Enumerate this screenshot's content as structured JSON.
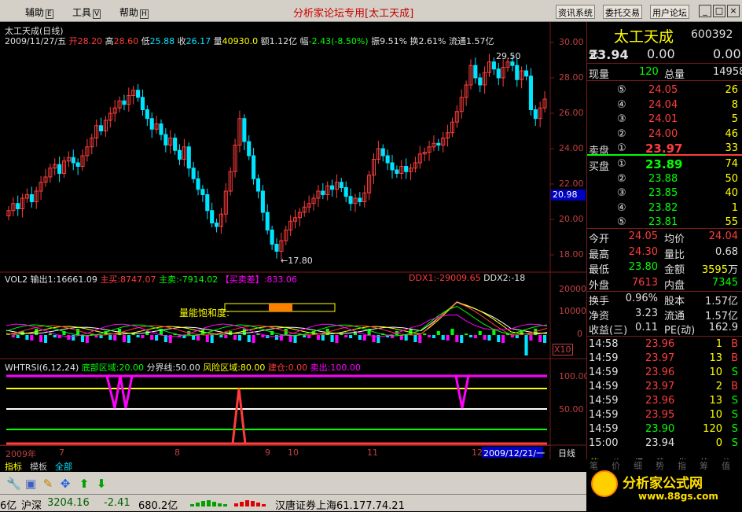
{
  "menubar": {
    "items": [
      {
        "label": "辅助",
        "key": "E"
      },
      {
        "label": "工具",
        "key": "V"
      },
      {
        "label": "帮助",
        "key": "H"
      }
    ],
    "app_title": "分析家论坛专用",
    "stock_bracket": "[太工天成]",
    "buttons": [
      "资讯系统",
      "委托交易",
      "用户论坛"
    ],
    "win_min": "_",
    "win_max": "□",
    "win_close": "×"
  },
  "price_panel": {
    "title": "太工天成(日线)",
    "date": "2009/11/27/五",
    "open_label": "开",
    "open": "28.20",
    "high_label": "高",
    "high": "28.60",
    "low_label": "低",
    "low": "25.88",
    "close_label": "收",
    "close": "26.17",
    "vol_label": "量",
    "vol": "40930.0",
    "amount_label": "额",
    "amount": "1.12亿",
    "change_label": "幅",
    "change": "-2.43(-8.50%)",
    "amp_label": "振",
    "amp": "9.51%",
    "turn_label": "换",
    "turn": "2.61%",
    "float_label": "流通",
    "float": "1.57亿",
    "peak_label": "29.50",
    "trough_label": "17.80",
    "y_ticks": [
      "30.00",
      "28.00",
      "26.00",
      "24.00",
      "22.00",
      "20.98",
      "20.00",
      "18.00"
    ]
  },
  "vol_panel": {
    "title": "VOL2",
    "out1": "输出1:16661.09",
    "main_buy": "主买:8747.07",
    "main_sell": "主卖:-7914.02",
    "diff": "【买卖差】:833.06",
    "ddx1": "DDX1:-29009.65",
    "ddx2": "DDX2:-18",
    "saturation": "量能饱和度:",
    "y_ticks": [
      "20000",
      "10000",
      "0"
    ],
    "unit": "X10"
  },
  "rsi_panel": {
    "title": "WHTRSI(6,12,24)",
    "bottom": "底部区域:20.00",
    "boundary": "分界线:50.00",
    "risk": "风险区域:80.00",
    "build": "建仓:0.00",
    "sell": "卖出:100.00",
    "y_ticks": [
      "100.00",
      "50.00"
    ]
  },
  "time_axis": {
    "labels": [
      "2009年",
      "7",
      "8",
      "9",
      "10",
      "11",
      "12"
    ],
    "current": "2009/12/21/一",
    "period": "日线"
  },
  "quote": {
    "name": "太工天成",
    "code": "600392",
    "price": "23.94",
    "price_unit": "元",
    "change": "0.00",
    "change2": "0.00",
    "now_vol_label": "现量",
    "now_vol": "120",
    "total_vol_label": "总量",
    "total_vol": "14958",
    "sell_label": "卖盘",
    "buy_label": "买盘",
    "asks": [
      {
        "lvl": "⑤",
        "price": "24.05",
        "vol": "26"
      },
      {
        "lvl": "④",
        "price": "24.04",
        "vol": "8"
      },
      {
        "lvl": "③",
        "price": "24.01",
        "vol": "5"
      },
      {
        "lvl": "②",
        "price": "24.00",
        "vol": "46"
      },
      {
        "lvl": "①",
        "price": "23.97",
        "vol": "33"
      }
    ],
    "bids": [
      {
        "lvl": "①",
        "price": "23.89",
        "vol": "74"
      },
      {
        "lvl": "②",
        "price": "23.88",
        "vol": "50"
      },
      {
        "lvl": "③",
        "price": "23.85",
        "vol": "40"
      },
      {
        "lvl": "④",
        "price": "23.82",
        "vol": "1"
      },
      {
        "lvl": "⑤",
        "price": "23.81",
        "vol": "55"
      }
    ],
    "stats": [
      {
        "l1": "今开",
        "v1": "24.05",
        "l2": "均价",
        "v2": "24.04"
      },
      {
        "l1": "最高",
        "v1": "24.30",
        "l2": "量比",
        "v2": "0.68"
      },
      {
        "l1": "最低",
        "v1": "23.80",
        "l2": "金额",
        "v2": "3595",
        "u2": "万"
      },
      {
        "l1": "外盘",
        "v1": "7613",
        "l2": "内盘",
        "v2": "7345"
      }
    ],
    "stats2": [
      {
        "l1": "换手",
        "v1": "0.96%",
        "l2": "股本",
        "v2": "1.57亿"
      },
      {
        "l1": "净资",
        "v1": "3.23",
        "l2": "流通",
        "v2": "1.57亿"
      },
      {
        "l1": "收益(三)",
        "v1": "0.11",
        "l2": "PE(动)",
        "v2": "162.9"
      }
    ],
    "ticks": [
      {
        "time": "14:58",
        "price": "23.96",
        "vol": "1",
        "side": "B"
      },
      {
        "time": "14:59",
        "price": "23.97",
        "vol": "13",
        "side": "B"
      },
      {
        "time": "14:59",
        "price": "23.96",
        "vol": "10",
        "side": "S"
      },
      {
        "time": "14:59",
        "price": "23.97",
        "vol": "2",
        "side": "B"
      },
      {
        "time": "14:59",
        "price": "23.96",
        "vol": "13",
        "side": "S"
      },
      {
        "time": "14:59",
        "price": "23.95",
        "vol": "10",
        "side": "S"
      },
      {
        "time": "14:59",
        "price": "23.90",
        "vol": "120",
        "side": "S"
      },
      {
        "time": "15:00",
        "price": "23.94",
        "vol": "0",
        "side": "S"
      }
    ],
    "tabs": [
      "笔",
      "价",
      "细",
      "势",
      "指",
      "筹",
      "值"
    ]
  },
  "bottom": {
    "tabs": [
      "指标",
      "模板",
      "全部"
    ],
    "index_name": "沪深",
    "index_val": "3204.16",
    "index_chg": "-2.41",
    "index_amt": "680.2亿",
    "broker": "汉唐证券上海61.177.74.21",
    "left_cut": "6亿",
    "logo_text": "分析家公式网",
    "logo_url": "www.88gs.com"
  },
  "colors": {
    "up": "#ff3c3c",
    "down": "#00e5ff",
    "axis": "#7a1a1a",
    "yellow": "#ffff00",
    "magenta": "#ff00ff"
  }
}
